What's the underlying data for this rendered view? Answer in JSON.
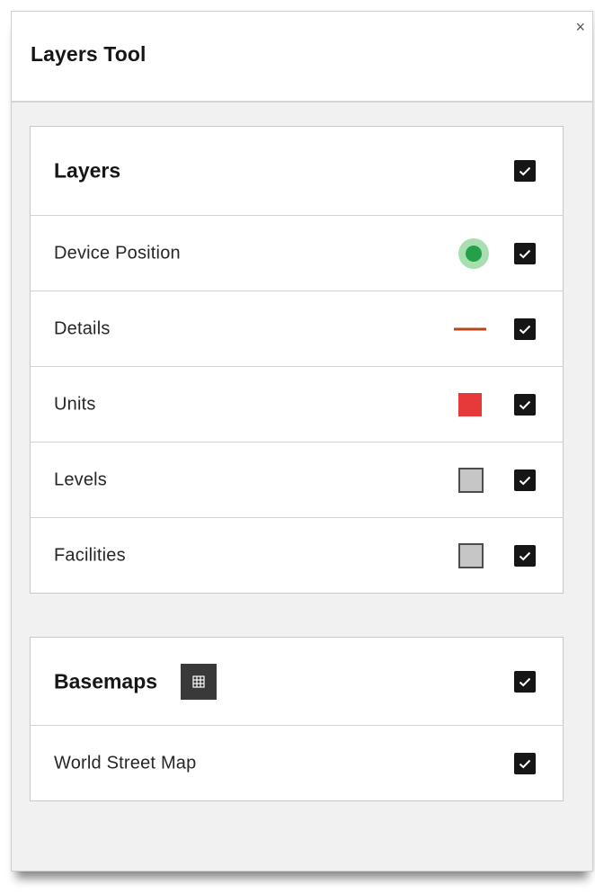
{
  "panel": {
    "title": "Layers Tool",
    "close_glyph": "×"
  },
  "layers": {
    "title": "Layers",
    "checked": true,
    "items": [
      {
        "label": "Device Position",
        "symbol": "green-point",
        "symbol_color": "#24a148",
        "checked": true
      },
      {
        "label": "Details",
        "symbol": "brown-line",
        "symbol_color": "#b5461b",
        "checked": true
      },
      {
        "label": "Units",
        "symbol": "red-fill",
        "symbol_color": "#e63a3a",
        "checked": true
      },
      {
        "label": "Levels",
        "symbol": "grey-fill",
        "symbol_color": "#c6c6c6",
        "checked": true
      },
      {
        "label": "Facilities",
        "symbol": "grey-fill",
        "symbol_color": "#c6c6c6",
        "checked": true
      }
    ]
  },
  "basemaps": {
    "title": "Basemaps",
    "gallery_icon": "grid-icon",
    "checked": true,
    "items": [
      {
        "label": "World Street Map",
        "checked": true
      }
    ]
  }
}
